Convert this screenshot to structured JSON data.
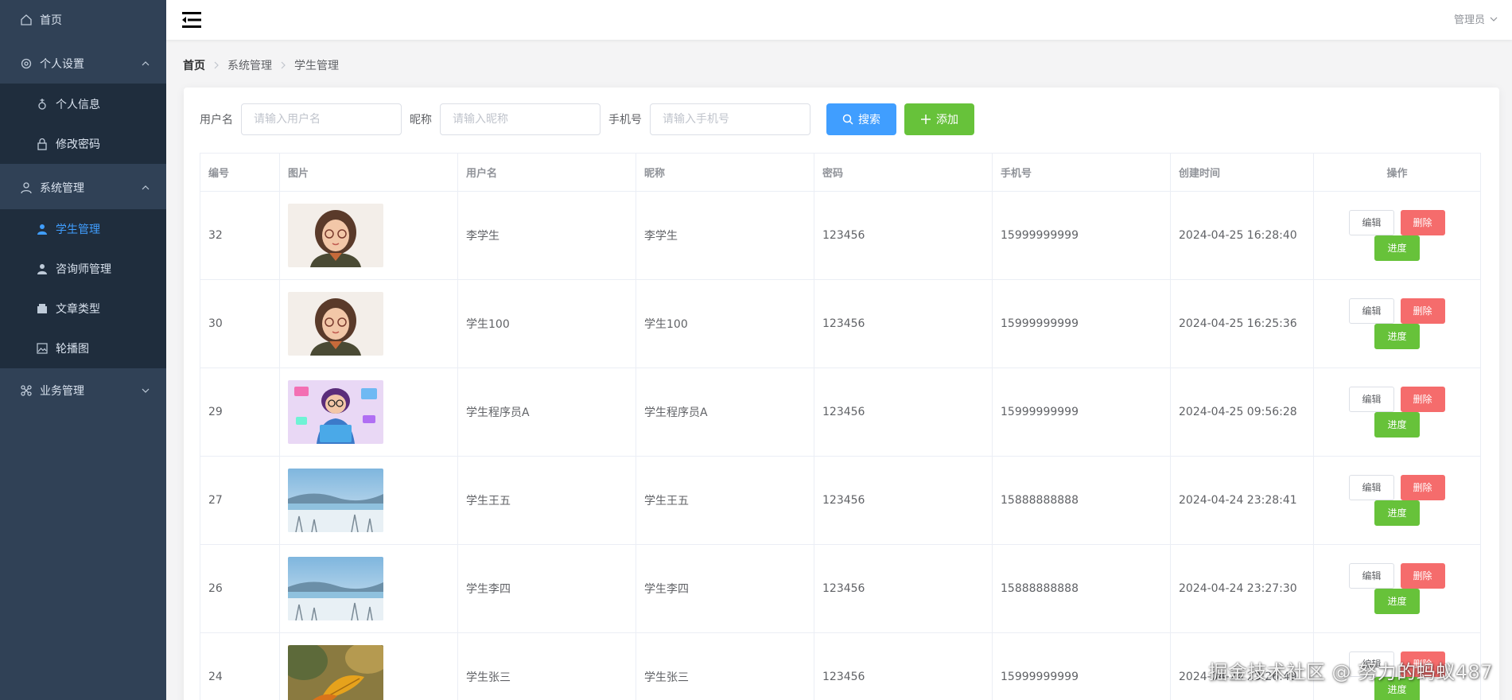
{
  "sidebar": {
    "home": "首页",
    "personal_settings": "个人设置",
    "personal_info": "个人信息",
    "change_password": "修改密码",
    "system_management": "系统管理",
    "student_management": "学生管理",
    "counselor_management": "咨询师管理",
    "article_type": "文章类型",
    "carousel": "轮播图",
    "business_management": "业务管理"
  },
  "header": {
    "user": "管理员"
  },
  "breadcrumb": [
    "首页",
    "系统管理",
    "学生管理"
  ],
  "search": {
    "username_label": "用户名",
    "username_placeholder": "请输入用户名",
    "nickname_label": "昵称",
    "nickname_placeholder": "请输入昵称",
    "phone_label": "手机号",
    "phone_placeholder": "请输入手机号",
    "search_button": "搜索",
    "add_button": "添加"
  },
  "table": {
    "headers": {
      "id": "编号",
      "image": "图片",
      "username": "用户名",
      "nickname": "昵称",
      "password": "密码",
      "phone": "手机号",
      "created": "创建时间",
      "actions": "操作"
    },
    "action_labels": {
      "edit": "编辑",
      "delete": "删除",
      "progress": "进度"
    },
    "rows": [
      {
        "id": "32",
        "image": "cartoon-girl-glasses",
        "username": "李学生",
        "nickname": "李学生",
        "password": "123456",
        "phone": "15999999999",
        "created": "2024-04-25 16:28:40"
      },
      {
        "id": "30",
        "image": "cartoon-girl-glasses",
        "username": "学生100",
        "nickname": "学生100",
        "password": "123456",
        "phone": "15999999999",
        "created": "2024-04-25 16:25:36"
      },
      {
        "id": "29",
        "image": "cartoon-programmer",
        "username": "学生程序员A",
        "nickname": "学生程序员A",
        "password": "123456",
        "phone": "15999999999",
        "created": "2024-04-25 09:56:28"
      },
      {
        "id": "27",
        "image": "snowy-landscape",
        "username": "学生王五",
        "nickname": "学生王五",
        "password": "123456",
        "phone": "15888888888",
        "created": "2024-04-24 23:28:41"
      },
      {
        "id": "26",
        "image": "snowy-landscape",
        "username": "学生李四",
        "nickname": "学生李四",
        "password": "123456",
        "phone": "15888888888",
        "created": "2024-04-24 23:27:30"
      },
      {
        "id": "24",
        "image": "autumn-leaf",
        "username": "学生张三",
        "nickname": "学生张三",
        "password": "123456",
        "phone": "15999999999",
        "created": "2024-04-24 23:26:49"
      }
    ]
  },
  "watermark": "掘金技术社区 @ 努力的蚂蚁487",
  "colors": {
    "sidebar_bg": "#304156",
    "submenu_bg": "#1f2d3d",
    "active": "#409eff",
    "primary": "#409eff",
    "success": "#67c23a",
    "danger": "#f56c6c"
  }
}
